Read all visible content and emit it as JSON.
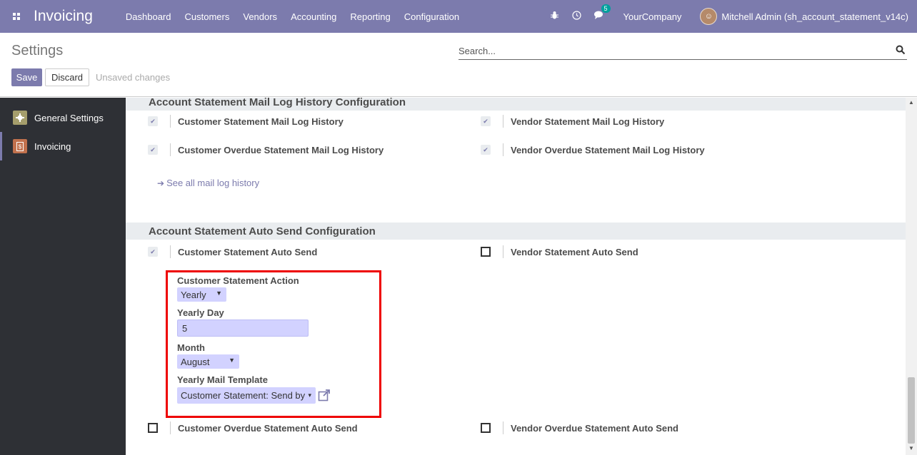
{
  "navbar": {
    "app_title": "Invoicing",
    "menu": [
      "Dashboard",
      "Customers",
      "Vendors",
      "Accounting",
      "Reporting",
      "Configuration"
    ],
    "chat_badge": "5",
    "company": "YourCompany",
    "user": "Mitchell Admin (sh_account_statement_v14c)",
    "icons": [
      "apps-icon",
      "bug-icon",
      "clock-icon",
      "chat-icon"
    ]
  },
  "control_panel": {
    "title": "Settings",
    "save_label": "Save",
    "discard_label": "Discard",
    "unsaved_label": "Unsaved changes",
    "search_placeholder": "Search..."
  },
  "sidebar": {
    "items": [
      {
        "label": "General Settings",
        "icon": "gear-icon",
        "color": "#a59e6c"
      },
      {
        "label": "Invoicing",
        "icon": "invoice-icon",
        "color": "#c1714d"
      }
    ]
  },
  "mail_log_section": {
    "title": "Account Statement Mail Log History Configuration",
    "customer_statement": {
      "label": "Customer Statement Mail Log History",
      "checked": true
    },
    "vendor_statement": {
      "label": "Vendor Statement Mail Log History",
      "checked": true
    },
    "customer_overdue": {
      "label": "Customer Overdue Statement Mail Log History",
      "checked": true
    },
    "vendor_overdue": {
      "label": "Vendor Overdue Statement Mail Log History",
      "checked": true
    },
    "see_all_link": "See all mail log history"
  },
  "auto_send_section": {
    "title": "Account Statement Auto Send Configuration",
    "customer_auto_send": {
      "label": "Customer Statement Auto Send",
      "checked": true
    },
    "vendor_auto_send": {
      "label": "Vendor Statement Auto Send",
      "checked": false
    },
    "action_label": "Customer Statement Action",
    "action_value": "Yearly",
    "yearly_day_label": "Yearly Day",
    "yearly_day_value": "5",
    "month_label": "Month",
    "month_value": "August",
    "template_label": "Yearly Mail Template",
    "template_value": "Customer Statement: Send by",
    "customer_overdue_auto_send": {
      "label": "Customer Overdue Statement Auto Send",
      "checked": false
    },
    "vendor_overdue_auto_send": {
      "label": "Vendor Overdue Statement Auto Send",
      "checked": false
    }
  },
  "colors": {
    "brand": "#7c7bad",
    "highlight_box": "#ee0000",
    "field_bg": "#d2d2ff"
  }
}
